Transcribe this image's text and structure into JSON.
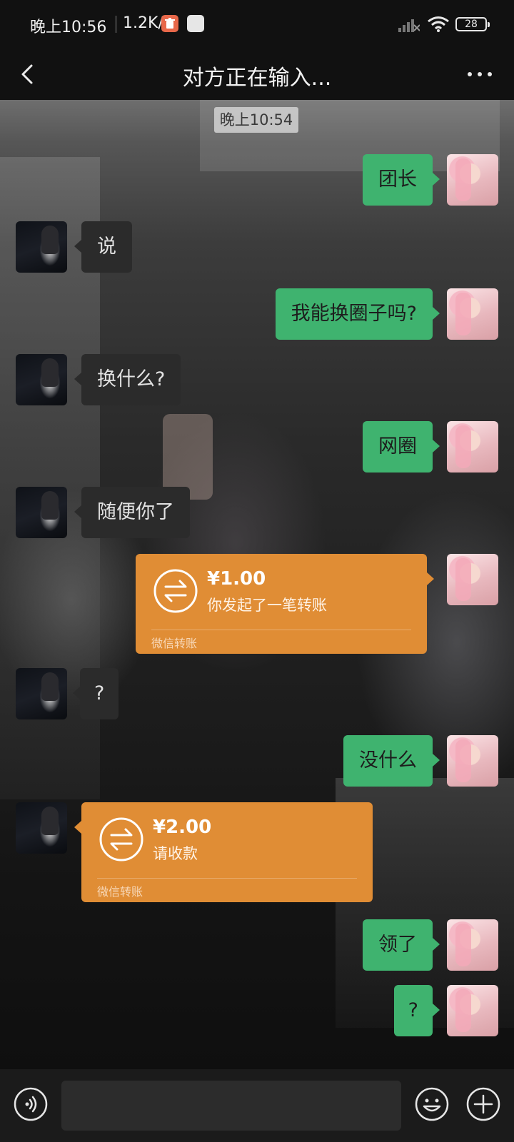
{
  "status_bar": {
    "time": "晚上10:56",
    "net_speed": "1.2K/s",
    "battery": "28"
  },
  "header": {
    "title": "对方正在输入..."
  },
  "chat": {
    "timestamp": "晚上10:54",
    "messages": [
      {
        "sender": "self",
        "type": "text",
        "text": "团长"
      },
      {
        "sender": "other",
        "type": "text",
        "text": "说"
      },
      {
        "sender": "self",
        "type": "text",
        "text": "我能换圈子吗?"
      },
      {
        "sender": "other",
        "type": "text",
        "text": "换什么?"
      },
      {
        "sender": "self",
        "type": "text",
        "text": "网圈"
      },
      {
        "sender": "other",
        "type": "text",
        "text": "随便你了"
      },
      {
        "sender": "self",
        "type": "transfer",
        "amount": "¥1.00",
        "desc": "你发起了一笔转账",
        "footer": "微信转账"
      },
      {
        "sender": "other",
        "type": "text",
        "text": "?"
      },
      {
        "sender": "self",
        "type": "text",
        "text": "没什么"
      },
      {
        "sender": "other",
        "type": "transfer",
        "amount": "¥2.00",
        "desc": "请收款",
        "footer": "微信转账"
      },
      {
        "sender": "self",
        "type": "text",
        "text": "领了"
      },
      {
        "sender": "self",
        "type": "text",
        "text": "?"
      }
    ]
  },
  "input_bar": {
    "placeholder": ""
  },
  "colors": {
    "self_bubble": "#3fb36f",
    "other_bubble": "#2b2b2b",
    "transfer": "#e08d35"
  }
}
